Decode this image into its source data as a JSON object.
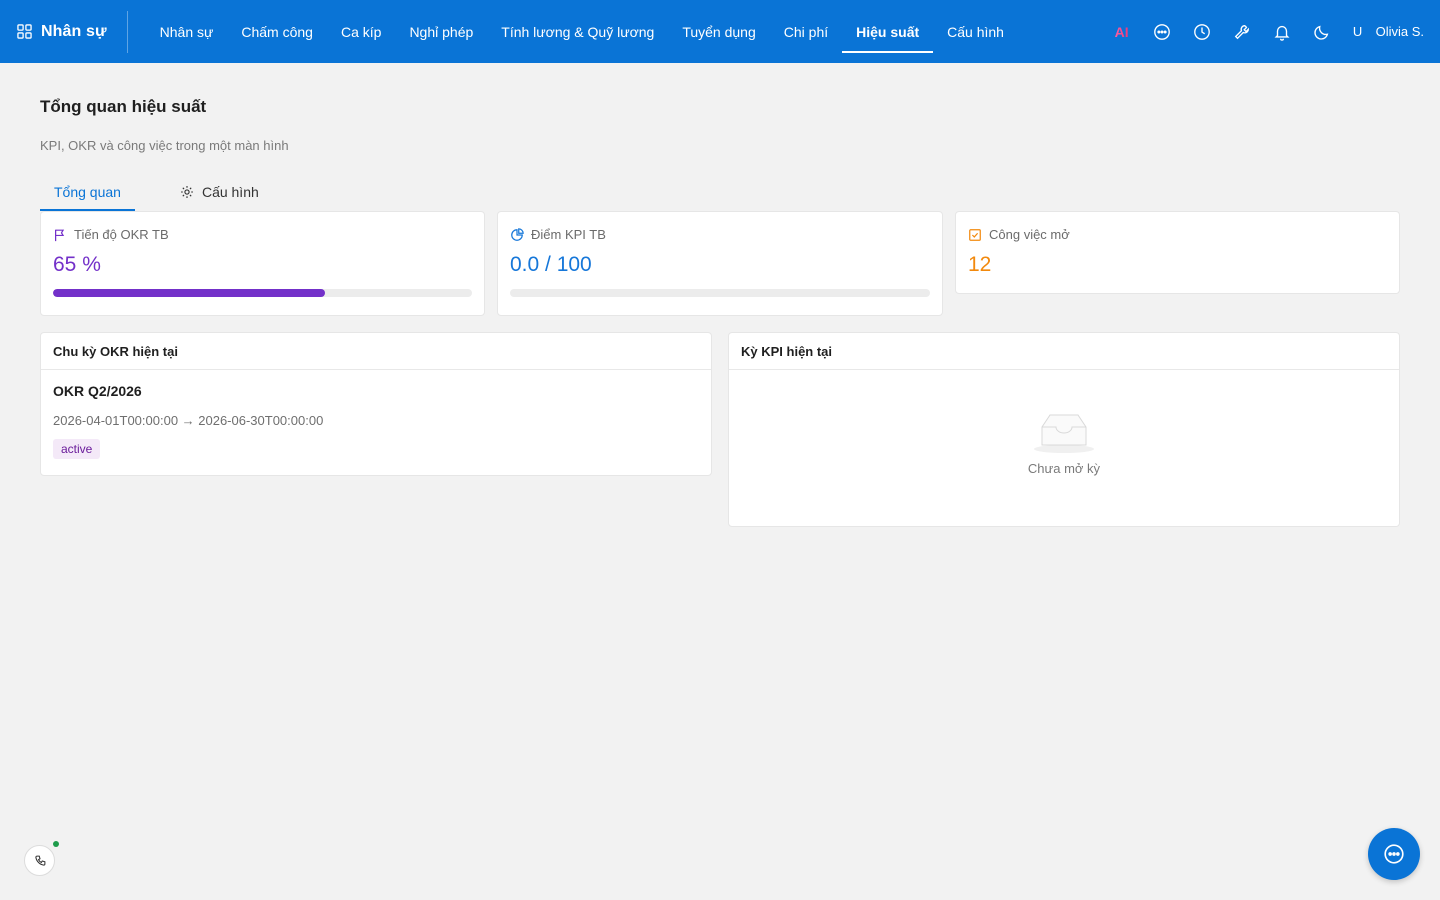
{
  "app": {
    "brand": "Nhân sự",
    "brand_icon": "grid-icon"
  },
  "nav": {
    "items": [
      {
        "label": "Nhân sự",
        "active": false
      },
      {
        "label": "Chấm công",
        "active": false
      },
      {
        "label": "Ca kíp",
        "active": false
      },
      {
        "label": "Nghỉ phép",
        "active": false
      },
      {
        "label": "Tính lương & Quỹ lương",
        "active": false
      },
      {
        "label": "Tuyển dụng",
        "active": false
      },
      {
        "label": "Chi phí",
        "active": false
      },
      {
        "label": "Hiệu suất",
        "active": true
      },
      {
        "label": "Cấu hình",
        "active": false
      }
    ]
  },
  "topbar": {
    "ai_label": "AI",
    "icons": [
      "chat-bubble-icon",
      "clock-icon",
      "wrench-icon",
      "bell-icon",
      "moon-icon"
    ],
    "avatar": "U",
    "user_name": "Olivia S."
  },
  "page": {
    "title": "Tổng quan hiệu suất",
    "subtitle": "KPI, OKR và công việc trong một màn hình"
  },
  "tabs": [
    {
      "label": "Tổng quan",
      "active": true
    },
    {
      "label": "Cấu hình",
      "active": false,
      "icon": "gear-icon"
    }
  ],
  "stats": {
    "okr": {
      "label": "Tiến độ OKR TB",
      "value": "65 %",
      "progress": 0.65,
      "color": "#7330c9",
      "icon": "flag-icon"
    },
    "kpi": {
      "label": "Điểm KPI TB",
      "value": "0.0 / 100",
      "progress": 0.0,
      "color": "#1677d9",
      "icon": "pie-chart-icon"
    },
    "tasks": {
      "label": "Công việc mở",
      "value": "12",
      "color": "#f2890d",
      "icon": "checkbox-icon"
    }
  },
  "okr_cycle": {
    "title": "Chu kỳ OKR hiện tại",
    "name": "OKR Q2/2026",
    "range": "2026-04-01T00:00:00 → 2026-06-30T00:00:00",
    "status": "active"
  },
  "kpi_period": {
    "title": "Kỳ KPI hiện tại",
    "empty_text": "Chưa mở kỳ"
  }
}
